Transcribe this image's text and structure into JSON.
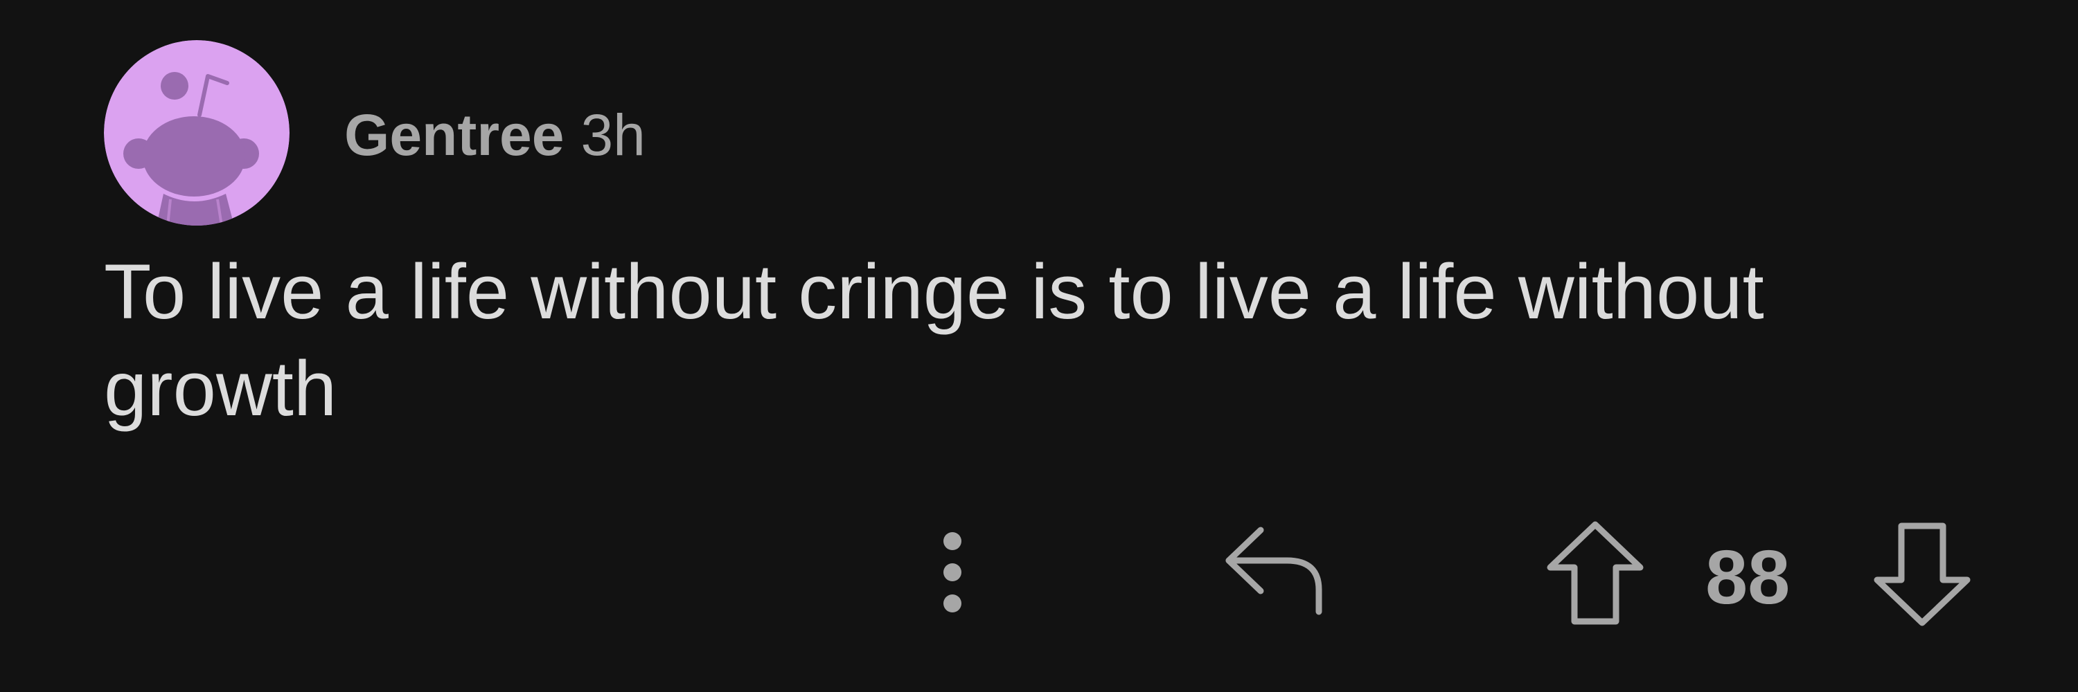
{
  "colors": {
    "background": "#121212",
    "avatar_background": "#dba2f0",
    "avatar_figure": "#9a6bb0",
    "meta_text": "#a6a6a6",
    "body_text": "#dcdcdc",
    "icon_stroke": "#a6a6a6"
  },
  "comment": {
    "author": "Gentree",
    "timestamp": "3h",
    "body": "To live a life without cringe is to live a life without growth",
    "score": "88"
  },
  "icons": {
    "avatar": "snoo-avatar",
    "more": "vertical-ellipsis-icon",
    "reply": "reply-arrow-icon",
    "upvote": "arrow-up-icon",
    "downvote": "arrow-down-icon"
  }
}
